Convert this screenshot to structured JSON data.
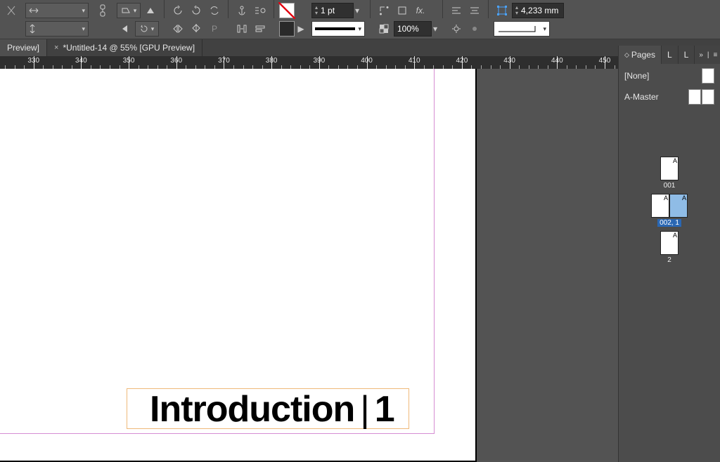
{
  "toolbar": {
    "stroke_weight": "1 pt",
    "zoom": "100%",
    "wh_value": "4,233 mm"
  },
  "tabs": [
    {
      "label": "Preview]",
      "active": true,
      "closable": false
    },
    {
      "label": "*Untitled-14 @ 55% [GPU Preview]",
      "active": false,
      "closable": true
    }
  ],
  "ruler": {
    "start": 320,
    "step": 10,
    "count": 14
  },
  "document": {
    "heading_text": "Introduction",
    "divider_char": "|",
    "page_number": "1"
  },
  "pages_panel": {
    "tab_pages": "Pages",
    "tab_layers1": "L",
    "tab_layers2": "L",
    "master_none": "[None]",
    "master_a": "A-Master",
    "thumbs": [
      {
        "label": "001",
        "pages": [
          "A"
        ],
        "selected": false
      },
      {
        "label": "002, 1",
        "pages": [
          "A",
          "A"
        ],
        "selected": true
      },
      {
        "label": "2",
        "pages": [
          "A"
        ],
        "selected": false
      }
    ]
  }
}
